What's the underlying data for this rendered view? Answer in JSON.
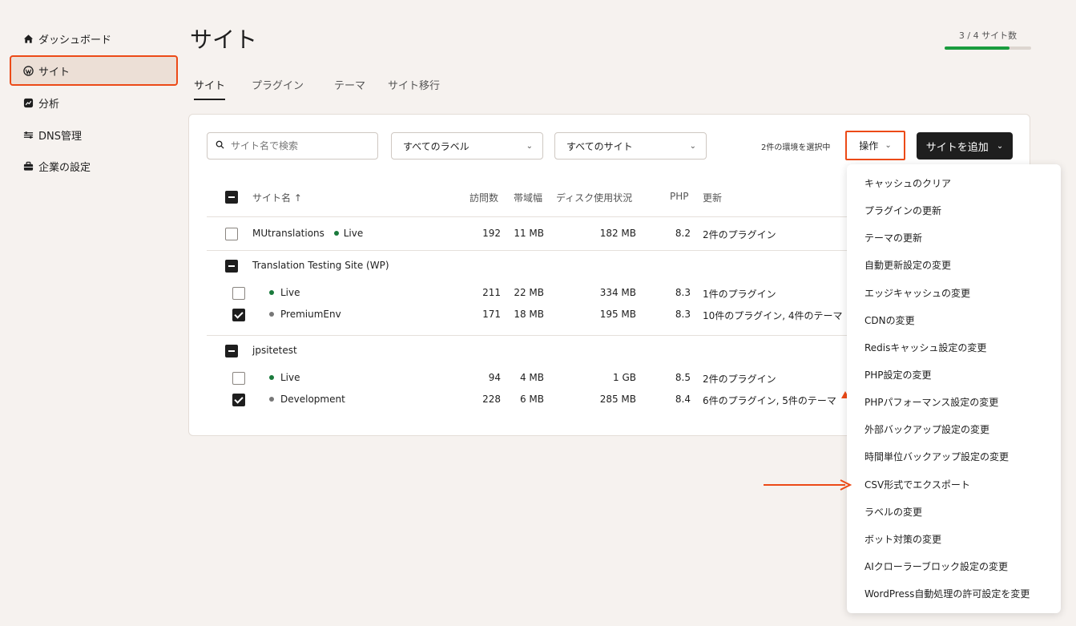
{
  "sidebar": {
    "items": [
      {
        "label": "ダッシュボード",
        "icon": "home-icon"
      },
      {
        "label": "サイト",
        "icon": "wordpress-icon",
        "active": true
      },
      {
        "label": "分析",
        "icon": "analytics-icon"
      },
      {
        "label": "DNS管理",
        "icon": "dns-icon"
      },
      {
        "label": "企業の設定",
        "icon": "briefcase-icon"
      }
    ]
  },
  "page": {
    "title": "サイト",
    "usage_text": "3 / 4 サイト数",
    "usage_fraction": 0.75
  },
  "tabs": [
    "サイト",
    "プラグイン",
    "テーマ",
    "サイト移行"
  ],
  "toolbar": {
    "search_placeholder": "サイト名で検索",
    "label_filter": "すべてのラベル",
    "site_filter": "すべてのサイト",
    "selected_count": "2件の環境を選択中",
    "ops_label": "操作",
    "add_label": "サイトを追加"
  },
  "table": {
    "headers": {
      "site": "サイト名 ↑",
      "visits": "訪問数",
      "bandwidth": "帯域幅",
      "disk": "ディスク使用状況",
      "php": "PHP",
      "updates": "更新"
    },
    "sites": [
      {
        "name": "MUtranslations",
        "env": "Live",
        "visits": "192",
        "bandwidth": "11 MB",
        "disk": "182 MB",
        "php": "8.2",
        "updates": "2件のプラグイン"
      },
      {
        "name": "Translation Testing Site (WP)",
        "envs": [
          {
            "name": "Live",
            "visits": "211",
            "bandwidth": "22 MB",
            "disk": "334 MB",
            "php": "8.3",
            "updates": "1件のプラグイン"
          },
          {
            "name": "PremiumEnv",
            "visits": "171",
            "bandwidth": "18 MB",
            "disk": "195 MB",
            "php": "8.3",
            "updates": "10件のプラグイン, 4件のテーマ"
          }
        ]
      },
      {
        "name": "jpsitetest",
        "envs": [
          {
            "name": "Live",
            "visits": "94",
            "bandwidth": "4 MB",
            "disk": "1 GB",
            "php": "8.5",
            "updates": "2件のプラグイン"
          },
          {
            "name": "Development",
            "visits": "228",
            "bandwidth": "6 MB",
            "disk": "285 MB",
            "php": "8.4",
            "updates": "6件のプラグイン, 5件のテーマ"
          }
        ]
      }
    ]
  },
  "menu": {
    "items": [
      "キャッシュのクリア",
      "プラグインの更新",
      "テーマの更新",
      "自動更新設定の変更",
      "エッジキャッシュの変更",
      "CDNの変更",
      "Redisキャッシュ設定の変更",
      "PHP設定の変更",
      "PHPパフォーマンス設定の変更",
      "外部バックアップ設定の変更",
      "時間単位バックアップ設定の変更",
      "CSV形式でエクスポート",
      "ラベルの変更",
      "ボット対策の変更",
      "AIクローラーブロック設定の変更",
      "WordPress自動処理の許可設定を変更"
    ]
  },
  "colors": {
    "accent": "#ec4a17",
    "live_dot": "#1a7a3c",
    "usage_fill": "#1a9c3e",
    "primary_button": "#1e1e1e"
  }
}
